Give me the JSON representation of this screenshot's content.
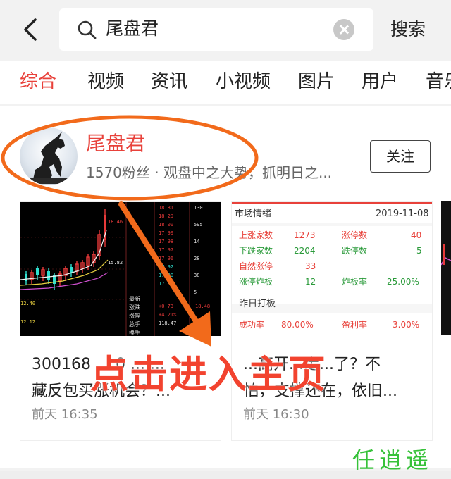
{
  "search": {
    "back_icon": "back-arrow-icon",
    "query": "尾盘君",
    "button_label": "搜索"
  },
  "tabs": [
    {
      "label": "综合",
      "active": true
    },
    {
      "label": "视频",
      "active": false
    },
    {
      "label": "资讯",
      "active": false
    },
    {
      "label": "小视频",
      "active": false
    },
    {
      "label": "图片",
      "active": false
    },
    {
      "label": "用户",
      "active": false
    },
    {
      "label": "音乐",
      "active": false
    }
  ],
  "user": {
    "name": "尾盘君",
    "description": "1570粉丝 · 观盘中之大势，抓明日之...",
    "follow_label": "关注"
  },
  "posts": [
    {
      "title_line1": "300168 ... 0 ... ...",
      "title_line2": "藏反包买涨机会？...",
      "time": "前天 16:35"
    },
    {
      "title_line1": "...高开...走...了？不",
      "title_line2": "怕，支撑还在，依旧...",
      "time": "前天 16:30",
      "market": {
        "title": "市场情绪",
        "date": "2019-11-08",
        "rows": [
          {
            "l1": "上涨家数",
            "v1": "1273",
            "l2": "涨停数",
            "v2": "40"
          },
          {
            "l1": "下跌家数",
            "v1": "2204",
            "l2": "跌停数",
            "v2": "5"
          },
          {
            "l1": "自然涨停",
            "v1": "33",
            "l2": "",
            "v2": ""
          },
          {
            "l1": "涨停炸板",
            "v1": "12",
            "l2": "炸板率",
            "v2": "25.00%"
          }
        ],
        "section": "昨日打板",
        "success_label": "成功率",
        "success_value": "80.00%",
        "profit_label": "盈利率",
        "profit_value": "3.00%"
      }
    }
  ],
  "overlay": {
    "text": "点击进入主页"
  },
  "watermark": "任逍遥",
  "colors": {
    "accent": "#e8413a",
    "annotation": "#f26a1b",
    "watermark": "#37c23a"
  }
}
